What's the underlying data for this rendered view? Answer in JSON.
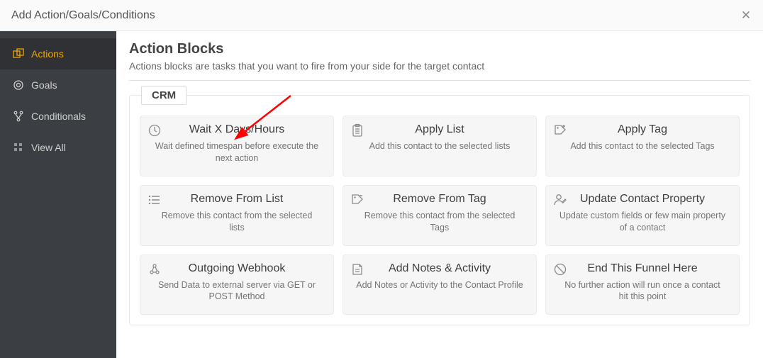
{
  "header": {
    "title": "Add Action/Goals/Conditions"
  },
  "sidebar": {
    "items": [
      {
        "label": "Actions"
      },
      {
        "label": "Goals"
      },
      {
        "label": "Conditionals"
      },
      {
        "label": "View All"
      }
    ]
  },
  "main": {
    "title": "Action Blocks",
    "subtitle": "Actions blocks are tasks that you want to fire from your side for the target contact",
    "group_label": "CRM",
    "cards": [
      {
        "title": "Wait X Days/Hours",
        "desc": "Wait defined timespan before execute the next action"
      },
      {
        "title": "Apply List",
        "desc": "Add this contact to the selected lists"
      },
      {
        "title": "Apply Tag",
        "desc": "Add this contact to the selected Tags"
      },
      {
        "title": "Remove From List",
        "desc": "Remove this contact from the selected lists"
      },
      {
        "title": "Remove From Tag",
        "desc": "Remove this contact from the selected Tags"
      },
      {
        "title": "Update Contact Property",
        "desc": "Update custom fields or few main property of a contact"
      },
      {
        "title": "Outgoing Webhook",
        "desc": "Send Data to external server via GET or POST Method"
      },
      {
        "title": "Add Notes & Activity",
        "desc": "Add Notes or Activity to the Contact Profile"
      },
      {
        "title": "End This Funnel Here",
        "desc": "No further action will run once a contact hit this point"
      }
    ]
  }
}
